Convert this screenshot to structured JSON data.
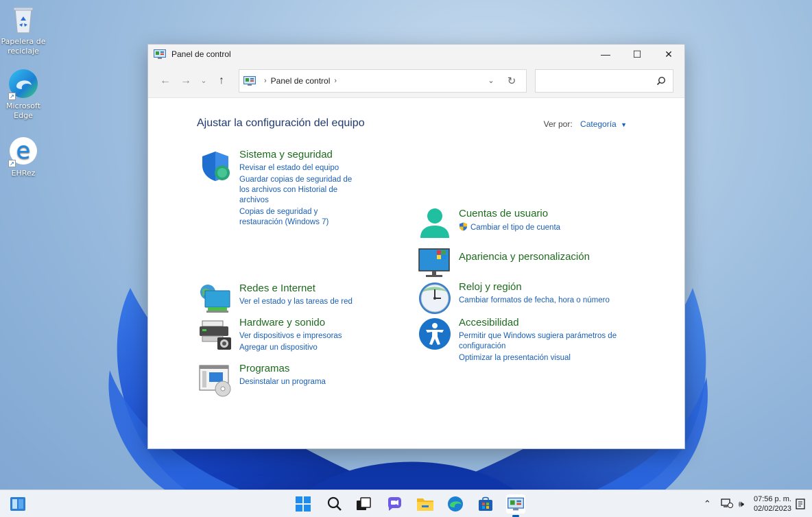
{
  "desktop": {
    "icons": [
      {
        "label": "Papelera de reciclaje"
      },
      {
        "label": "Microsoft Edge"
      },
      {
        "label": "EHRez"
      }
    ]
  },
  "window": {
    "title": "Panel de control",
    "controls": {
      "minimize": "—",
      "maximize": "☐",
      "close": "✕"
    },
    "nav": {
      "back": "←",
      "forward": "→",
      "recent": "⌄",
      "up": "↑"
    },
    "address": {
      "crumb": "Panel de control",
      "separator": "›"
    },
    "search": {
      "placeholder": "",
      "icon": "search-icon"
    }
  },
  "content": {
    "heading": "Ajustar la configuración del equipo",
    "view_by_label": "Ver por:",
    "view_by_value": "Categoría",
    "left": [
      {
        "title": "Sistema y seguridad",
        "icon": "shield-icon",
        "links": [
          "Revisar el estado del equipo",
          "Guardar copias de seguridad de los archivos con Historial de archivos",
          "Copias de seguridad y restauración (Windows 7)"
        ]
      },
      {
        "title": "Redes e Internet",
        "icon": "network-icon",
        "links": [
          "Ver el estado y las tareas de red"
        ]
      },
      {
        "title": "Hardware y sonido",
        "icon": "printer-icon",
        "links": [
          "Ver dispositivos e impresoras",
          "Agregar un dispositivo"
        ]
      },
      {
        "title": "Programas",
        "icon": "programs-icon",
        "links": [
          "Desinstalar un programa"
        ]
      }
    ],
    "right": [
      {
        "title": "Cuentas de usuario",
        "icon": "user-icon",
        "links": [
          "Cambiar el tipo de cuenta"
        ]
      },
      {
        "title": "Apariencia y personalización",
        "icon": "monitor-icon",
        "links": []
      },
      {
        "title": "Reloj y región",
        "icon": "clock-icon",
        "links": [
          "Cambiar formatos de fecha, hora o número"
        ]
      },
      {
        "title": "Accesibilidad",
        "icon": "accessibility-icon",
        "links": [
          "Permitir que Windows sugiera parámetros de configuración",
          "Optimizar la presentación visual"
        ]
      }
    ]
  },
  "taskbar": {
    "time": "07:56 p. m.",
    "date": "02/02/2023"
  },
  "colors": {
    "accent": "#005fb8",
    "link": "#1a5fb4",
    "category_title": "#1e6b1e",
    "heading": "#1e3a6e"
  }
}
